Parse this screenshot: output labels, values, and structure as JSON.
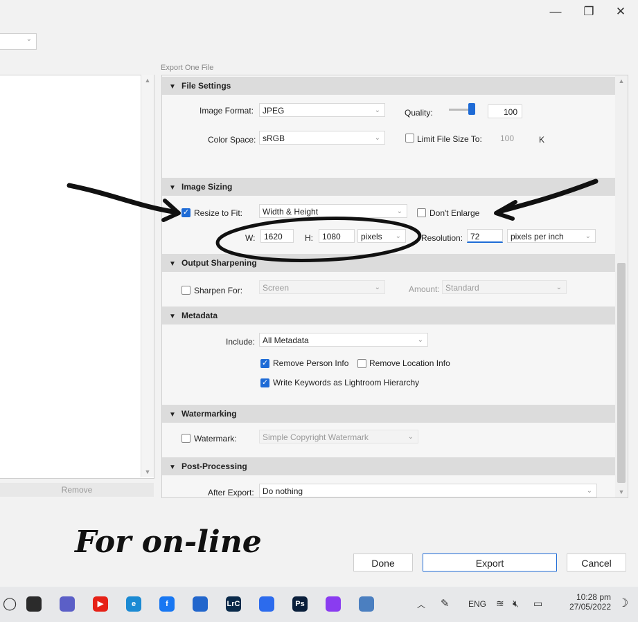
{
  "window": {
    "minimize_glyph": "—",
    "restore_glyph": "❐",
    "close_glyph": "✕"
  },
  "left_panel": {
    "remove_label": "Remove"
  },
  "dialog": {
    "title": "Export One File",
    "sections": {
      "file_settings": "File Settings",
      "image_sizing": "Image Sizing",
      "output_sharpening": "Output Sharpening",
      "metadata": "Metadata",
      "watermarking": "Watermarking",
      "post_processing": "Post-Processing"
    },
    "file_settings": {
      "image_format_label": "Image Format:",
      "image_format_value": "JPEG",
      "quality_label": "Quality:",
      "quality_value": "100",
      "quality_fraction": 1.0,
      "color_space_label": "Color Space:",
      "color_space_value": "sRGB",
      "limit_file_size_label": "Limit File Size To:",
      "limit_file_size_value": "100",
      "limit_file_size_unit": "K",
      "limit_file_size_checked": false
    },
    "image_sizing": {
      "resize_label": "Resize to Fit:",
      "resize_checked": true,
      "resize_mode": "Width & Height",
      "dont_enlarge_label": "Don't Enlarge",
      "dont_enlarge_checked": false,
      "w_label": "W:",
      "w_value": "1620",
      "h_label": "H:",
      "h_value": "1080",
      "units": "pixels",
      "resolution_label": "Resolution:",
      "resolution_value": "72",
      "resolution_units": "pixels per inch"
    },
    "output_sharpening": {
      "sharpen_label": "Sharpen For:",
      "sharpen_checked": false,
      "sharpen_value": "Screen",
      "amount_label": "Amount:",
      "amount_value": "Standard"
    },
    "metadata": {
      "include_label": "Include:",
      "include_value": "All Metadata",
      "remove_person_label": "Remove Person Info",
      "remove_person_checked": true,
      "remove_location_label": "Remove Location Info",
      "remove_location_checked": false,
      "write_keywords_label": "Write Keywords as Lightroom Hierarchy",
      "write_keywords_checked": true
    },
    "watermarking": {
      "watermark_label": "Watermark:",
      "watermark_checked": false,
      "watermark_value": "Simple Copyright Watermark"
    },
    "post_processing": {
      "after_export_label": "After Export:",
      "after_export_value": "Do nothing"
    },
    "buttons": {
      "done": "Done",
      "export": "Export",
      "cancel": "Cancel"
    }
  },
  "annotation": {
    "handwritten_note": "For on-line"
  },
  "taskbar": {
    "apps": [
      {
        "name": "Outlook",
        "glyph": "",
        "color": "#2b2b2b"
      },
      {
        "name": "Teams",
        "glyph": "",
        "color": "#5b5fc7"
      },
      {
        "name": "YouTube",
        "glyph": "▶",
        "color": "#e62117"
      },
      {
        "name": "Edge",
        "glyph": "e",
        "color": "#1b8ad3"
      },
      {
        "name": "Facebook",
        "glyph": "f",
        "color": "#1877f2"
      },
      {
        "name": "Store",
        "glyph": "",
        "color": "#2266cc"
      },
      {
        "name": "Lightroom Classic",
        "glyph": "LrC",
        "color": "#0a2a4a"
      },
      {
        "name": "Signal",
        "glyph": "",
        "color": "#2c6bed"
      },
      {
        "name": "Photoshop",
        "glyph": "Ps",
        "color": "#0a1f3b"
      },
      {
        "name": "Messenger",
        "glyph": "",
        "color": "#8a3cf0"
      },
      {
        "name": "Notepad",
        "glyph": "",
        "color": "#4b7fc0"
      }
    ],
    "language": "ENG",
    "time": "10:28 pm",
    "date": "27/05/2022"
  },
  "colors": {
    "accent": "#1e6bd6",
    "section_bg": "#dcdcdc",
    "panel_bg": "#f6f6f6"
  }
}
